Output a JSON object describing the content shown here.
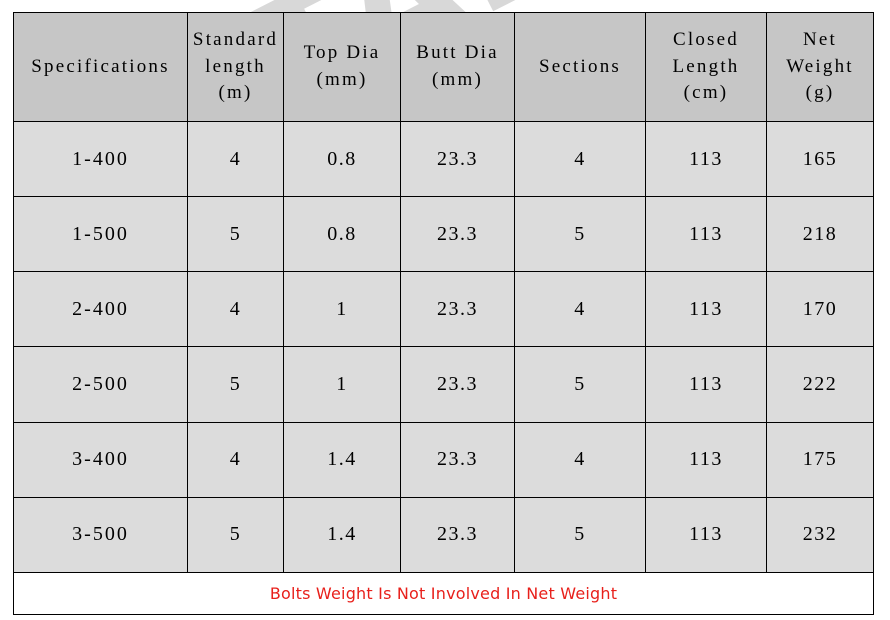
{
  "watermark": {
    "text": "VTAPS"
  },
  "table": {
    "headers": [
      {
        "lines": [
          "Specifications"
        ]
      },
      {
        "lines": [
          "Standard",
          "length",
          "(m)"
        ]
      },
      {
        "lines": [
          "Top Dia",
          "(mm)"
        ]
      },
      {
        "lines": [
          "Butt Dia",
          "(mm)"
        ]
      },
      {
        "lines": [
          "Sections"
        ]
      },
      {
        "lines": [
          "Closed",
          "Length",
          "(cm)"
        ]
      },
      {
        "lines": [
          "Net",
          "Weight",
          "(g)"
        ]
      }
    ],
    "rows": [
      {
        "specifications": "1-400",
        "standard_length": "4",
        "top_dia": "0.8",
        "butt_dia": "23.3",
        "sections": "4",
        "closed_length": "113",
        "net_weight": "165"
      },
      {
        "specifications": "1-500",
        "standard_length": "5",
        "top_dia": "0.8",
        "butt_dia": "23.3",
        "sections": "5",
        "closed_length": "113",
        "net_weight": "218"
      },
      {
        "specifications": "2-400",
        "standard_length": "4",
        "top_dia": "1",
        "butt_dia": "23.3",
        "sections": "4",
        "closed_length": "113",
        "net_weight": "170"
      },
      {
        "specifications": "2-500",
        "standard_length": "5",
        "top_dia": "1",
        "butt_dia": "23.3",
        "sections": "5",
        "closed_length": "113",
        "net_weight": "222"
      },
      {
        "specifications": "3-400",
        "standard_length": "4",
        "top_dia": "1.4",
        "butt_dia": "23.3",
        "sections": "4",
        "closed_length": "113",
        "net_weight": "175"
      },
      {
        "specifications": "3-500",
        "standard_length": "5",
        "top_dia": "1.4",
        "butt_dia": "23.3",
        "sections": "5",
        "closed_length": "113",
        "net_weight": "232"
      }
    ],
    "footer_note": "Bolts Weight Is Not Involved In Net Weight"
  },
  "colors": {
    "header_background": "#c6c6c6",
    "body_background": "#dcdcdc",
    "footer_background": "#ffffff",
    "footer_text": "#e8201b",
    "border": "#000000",
    "watermark": "#b9b9b9"
  }
}
